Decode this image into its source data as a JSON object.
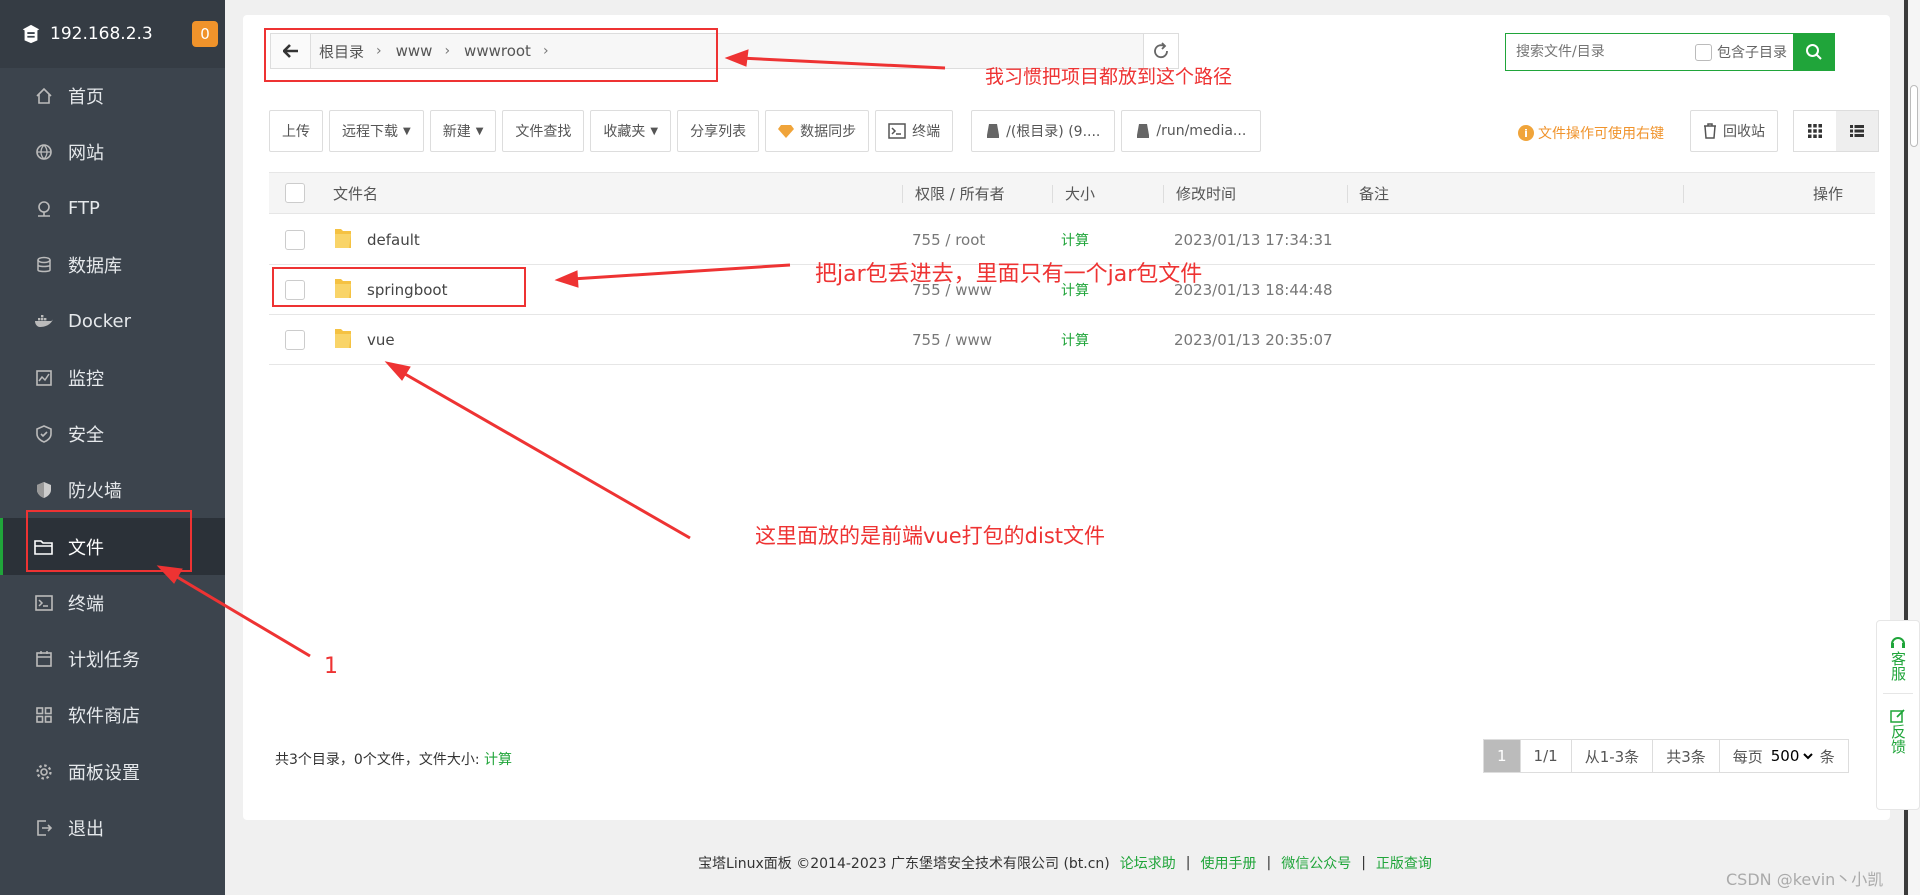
{
  "sidebar": {
    "ip": "192.168.2.3",
    "badge": "0",
    "items": [
      {
        "label": "首页",
        "icon": "home-icon"
      },
      {
        "label": "网站",
        "icon": "globe-icon"
      },
      {
        "label": "FTP",
        "icon": "ftp-icon"
      },
      {
        "label": "数据库",
        "icon": "database-icon"
      },
      {
        "label": "Docker",
        "icon": "docker-icon"
      },
      {
        "label": "监控",
        "icon": "monitor-icon"
      },
      {
        "label": "安全",
        "icon": "shield-icon"
      },
      {
        "label": "防火墙",
        "icon": "firewall-icon"
      },
      {
        "label": "文件",
        "icon": "folder-icon"
      },
      {
        "label": "终端",
        "icon": "terminal-icon"
      },
      {
        "label": "计划任务",
        "icon": "calendar-icon"
      },
      {
        "label": "软件商店",
        "icon": "apps-icon"
      },
      {
        "label": "面板设置",
        "icon": "gear-icon"
      },
      {
        "label": "退出",
        "icon": "logout-icon"
      }
    ],
    "active_index": 8
  },
  "path": {
    "crumbs": [
      "根目录",
      "www",
      "wwwroot"
    ]
  },
  "search": {
    "placeholder": "搜索文件/目录",
    "include_sub": "包含子目录"
  },
  "toolbar": {
    "upload": "上传",
    "remote_download": "远程下载",
    "new": "新建",
    "file_search": "文件查找",
    "favorites": "收藏夹",
    "share_list": "分享列表",
    "data_sync": "数据同步",
    "terminal": "终端",
    "disk_root": "/(根目录) (9....",
    "disk_media": "/run/media...",
    "tip": "文件操作可使用右键",
    "recycle": "回收站"
  },
  "table": {
    "headers": {
      "name": "文件名",
      "perm": "权限 / 所有者",
      "size": "大小",
      "mtime": "修改时间",
      "note": "备注",
      "ops": "操作"
    },
    "rows": [
      {
        "name": "default",
        "perm": "755 / root",
        "size": "计算",
        "mtime": "2023/01/13 17:34:31"
      },
      {
        "name": "springboot",
        "perm": "755 / www",
        "size": "计算",
        "mtime": "2023/01/13 18:44:48"
      },
      {
        "name": "vue",
        "perm": "755 / www",
        "size": "计算",
        "mtime": "2023/01/13 20:35:07"
      }
    ]
  },
  "summary": {
    "text": "共3个目录，0个文件，文件大小:",
    "calc": "计算"
  },
  "pager": {
    "current": "1",
    "pages": "1/1",
    "range": "从1-3条",
    "total": "共3条",
    "per_page_label": "每页",
    "per_page_value": "500",
    "unit": "条"
  },
  "service": {
    "support": "客服",
    "feedback": "反馈"
  },
  "footer": {
    "copyright": "宝塔Linux面板 ©2014-2023 广东堡塔安全技术有限公司 (bt.cn)",
    "links": [
      "论坛求助",
      "使用手册",
      "微信公众号",
      "正版查询"
    ]
  },
  "watermark": "CSDN @kevin丶小凯",
  "annotations": {
    "path_note": "我习惯把项目都放到这个路径",
    "jar_note": "把jar包丢进去，里面只有一个jar包文件",
    "vue_note": "这里面放的是前端vue打包的dist文件",
    "step": "1"
  },
  "colors": {
    "accent": "#20a53a",
    "sidebar": "#3c444d",
    "annotation": "#ee3333",
    "tip": "#f0932b"
  }
}
